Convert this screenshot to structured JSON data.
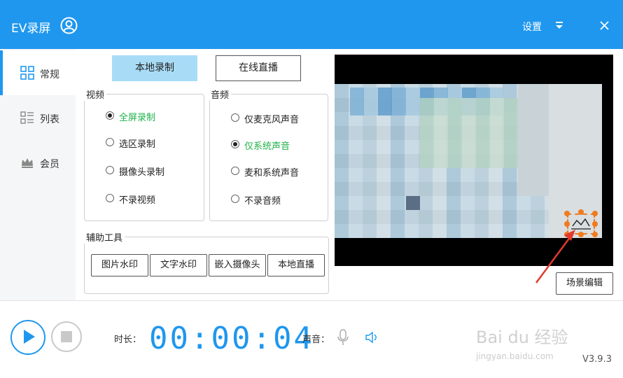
{
  "window": {
    "title": "EV录屏",
    "settings_label": "设置",
    "close_label": "×"
  },
  "sidebar": {
    "items": [
      {
        "label": "常规",
        "icon": "grid-icon",
        "active": true
      },
      {
        "label": "列表",
        "icon": "list-icon",
        "active": false
      },
      {
        "label": "会员",
        "icon": "crown-icon",
        "active": false
      }
    ]
  },
  "tabs": {
    "local": "本地录制",
    "live": "在线直播"
  },
  "video": {
    "title": "视频",
    "options": [
      "全屏录制",
      "选区录制",
      "摄像头录制",
      "不录视频"
    ],
    "selected": "全屏录制"
  },
  "audio": {
    "title": "音频",
    "options": [
      "仅麦克风声音",
      "仅系统声音",
      "麦和系统声音",
      "不录音频"
    ],
    "selected": "仅系统声音"
  },
  "tools": {
    "title": "辅助工具",
    "buttons": [
      "图片水印",
      "文字水印",
      "嵌入摄像头",
      "本地直播"
    ]
  },
  "preview": {
    "scene_edit": "场景编辑"
  },
  "bottom": {
    "duration_label": "时长：",
    "timer": "00:00:04",
    "sound_label": "声音：",
    "version": "V3.9.3"
  },
  "colors": {
    "accent": "#1f97ee",
    "selected_text": "#20b34a",
    "tab_active_bg": "#a8dcf6",
    "watermark_orange": "#f07a1e"
  },
  "watermark": {
    "brand": "Bai du 经验",
    "url": "jingyan.baidu.com"
  }
}
